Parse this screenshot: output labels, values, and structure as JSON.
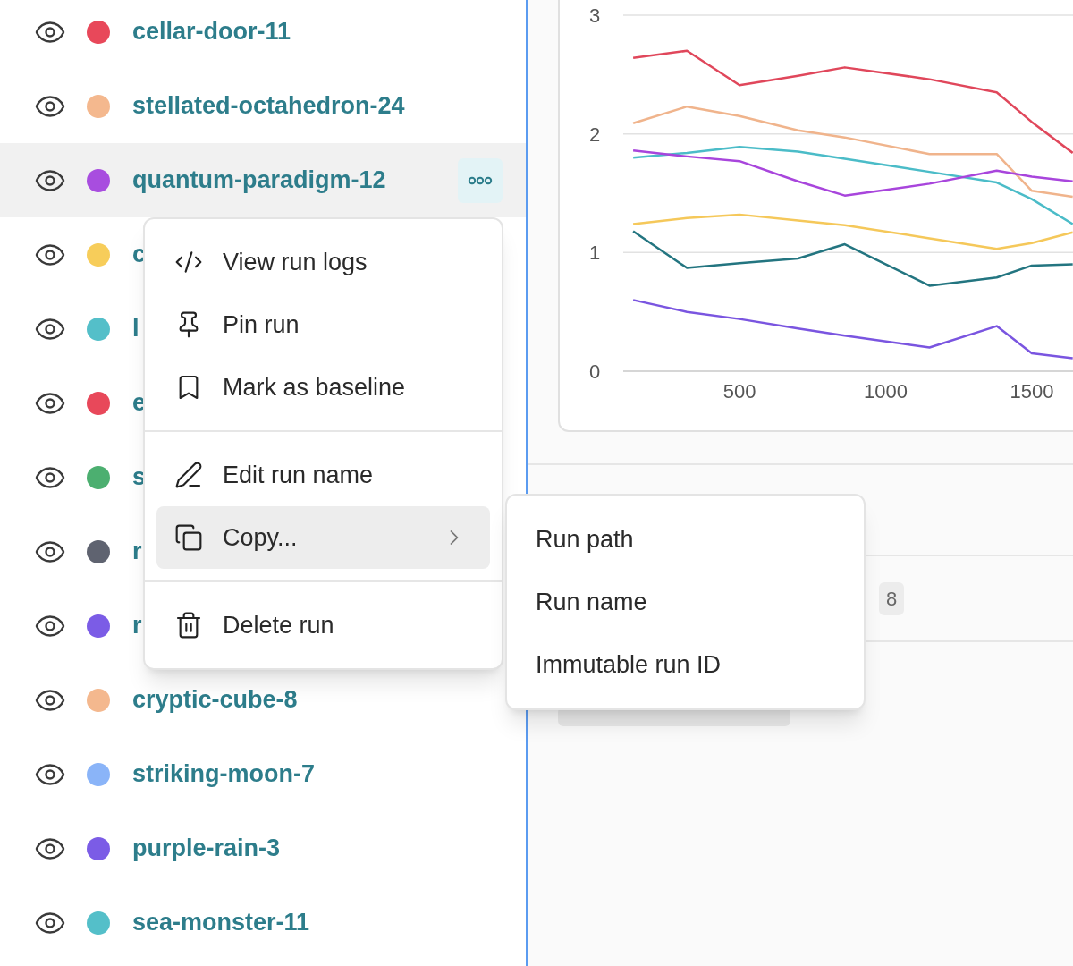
{
  "runs": [
    {
      "name": "cellar-door-11",
      "color": "#e8485a",
      "selected": false
    },
    {
      "name": "stellated-octahedron-24",
      "color": "#f4b88e",
      "selected": false
    },
    {
      "name": "quantum-paradigm-12",
      "color": "#a84ddf",
      "selected": true
    },
    {
      "name": "c",
      "color": "#f7cd5a",
      "selected": false
    },
    {
      "name": "l",
      "color": "#54bfc9",
      "selected": false
    },
    {
      "name": "e",
      "color": "#e8485a",
      "selected": false
    },
    {
      "name": "s",
      "color": "#4caf70",
      "selected": false
    },
    {
      "name": "r",
      "color": "#5f6370",
      "selected": false
    },
    {
      "name": "r",
      "color": "#7b5ce6",
      "selected": false
    },
    {
      "name": "cryptic-cube-8",
      "color": "#f4b88e",
      "selected": false
    },
    {
      "name": "striking-moon-7",
      "color": "#8ab4f8",
      "selected": false
    },
    {
      "name": "purple-rain-3",
      "color": "#7b5ce6",
      "selected": false
    },
    {
      "name": "sea-monster-11",
      "color": "#54bfc9",
      "selected": false
    }
  ],
  "context_menu": {
    "groups": [
      [
        {
          "label": "View run logs",
          "highlighted": false,
          "submenu": false
        },
        {
          "label": "Pin run",
          "highlighted": false,
          "submenu": false
        },
        {
          "label": "Mark as baseline",
          "highlighted": false,
          "submenu": false
        }
      ],
      [
        {
          "label": "Edit run name",
          "highlighted": false,
          "submenu": false
        },
        {
          "label": "Copy...",
          "highlighted": true,
          "submenu": true
        }
      ],
      [
        {
          "label": "Delete run",
          "highlighted": false,
          "submenu": false
        }
      ]
    ]
  },
  "submenu": {
    "items": [
      "Run path",
      "Run name",
      "Immutable run ID"
    ]
  },
  "chart": {
    "chart_data": {
      "type": "line",
      "x": [
        136,
        320,
        500,
        700,
        860,
        1150,
        1380,
        1500,
        1640
      ],
      "xlim": [
        102,
        1641
      ],
      "ylim": [
        0,
        3
      ],
      "xticks": [
        500,
        1000,
        1500
      ],
      "yticks": [
        0,
        1,
        2,
        3
      ],
      "series": [
        {
          "color": "#e0475b",
          "values": [
            2.64,
            2.7,
            2.41,
            2.49,
            2.56,
            2.46,
            2.35,
            2.1,
            1.84
          ]
        },
        {
          "color": "#f0b48c",
          "values": [
            2.09,
            2.23,
            2.15,
            2.03,
            1.97,
            1.83,
            1.83,
            1.52,
            1.47
          ]
        },
        {
          "color": "#4bbcc8",
          "values": [
            1.8,
            1.84,
            1.89,
            1.85,
            1.79,
            1.68,
            1.59,
            1.45,
            1.24
          ]
        },
        {
          "color": "#a845dc",
          "values": [
            1.86,
            1.81,
            1.77,
            1.6,
            1.48,
            1.58,
            1.69,
            1.64,
            1.6
          ]
        },
        {
          "color": "#f5c85a",
          "values": [
            1.24,
            1.29,
            1.32,
            1.27,
            1.23,
            1.12,
            1.03,
            1.08,
            1.17
          ]
        },
        {
          "color": "#237580",
          "values": [
            1.18,
            0.87,
            0.91,
            0.95,
            1.07,
            0.72,
            0.79,
            0.89,
            0.9
          ]
        },
        {
          "color": "#7a55e0",
          "values": [
            0.6,
            0.5,
            0.44,
            0.36,
            0.3,
            0.2,
            0.38,
            0.15,
            0.11
          ]
        }
      ]
    }
  },
  "panel_row": {
    "badge": "8"
  }
}
